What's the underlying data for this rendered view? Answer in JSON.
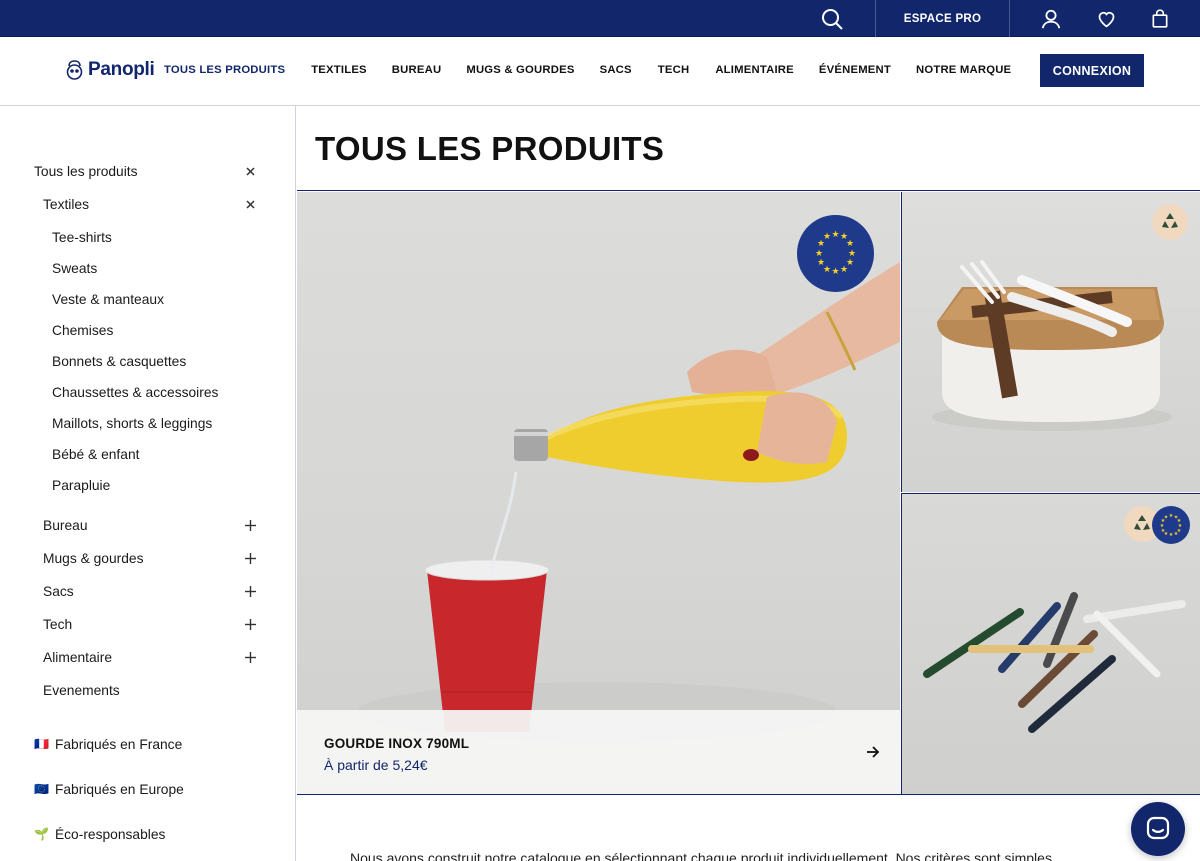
{
  "topbar": {
    "espace_pro": "ESPACE PRO",
    "icons": [
      "search-icon",
      "user-icon",
      "heart-icon",
      "bag-icon"
    ]
  },
  "nav": {
    "logo": "Panopli",
    "items": [
      {
        "label": "TOUS LES PRODUITS",
        "active": true
      },
      {
        "label": "TEXTILES"
      },
      {
        "label": "BUREAU"
      },
      {
        "label": "MUGS & GOURDES"
      },
      {
        "label": "SACS"
      },
      {
        "label": "TECH"
      },
      {
        "label": "ALIMENTAIRE"
      },
      {
        "label": "ÉVÉNEMENT"
      },
      {
        "label": "NOTRE MARQUE"
      }
    ],
    "connexion": "CONNEXION"
  },
  "sidebar": {
    "root": "Tous les produits",
    "textiles": "Textiles",
    "textiles_children": [
      "Tee-shirts",
      "Sweats",
      "Veste & manteaux",
      "Chemises",
      "Bonnets & casquettes",
      "Chaussettes & accessoires",
      "Maillots, shorts & leggings",
      "Bébé & enfant",
      "Parapluie"
    ],
    "categories": [
      {
        "label": "Bureau",
        "expandable": true
      },
      {
        "label": "Mugs & gourdes",
        "expandable": true
      },
      {
        "label": "Sacs",
        "expandable": true
      },
      {
        "label": "Tech",
        "expandable": true
      },
      {
        "label": "Alimentaire",
        "expandable": true
      },
      {
        "label": "Evenements",
        "expandable": false
      }
    ],
    "filters": [
      {
        "flag": "🇫🇷",
        "label": "Fabriqués en France"
      },
      {
        "flag": "🇪🇺",
        "label": "Fabriqués en Europe"
      },
      {
        "flag": "🌱",
        "label": "Éco-responsables"
      }
    ]
  },
  "main": {
    "title": "TOUS LES PRODUITS",
    "featured": {
      "name": "GOURDE INOX 790ML",
      "price": "À partir de 5,24€"
    },
    "intro": "Nous avons construit notre catalogue en sélectionnant chaque produit individuellement. Nos critères sont simples"
  },
  "colors": {
    "brand": "#12276b",
    "eu_badge": "#1f3a8a",
    "eco_badge": "#f1d9c0"
  }
}
